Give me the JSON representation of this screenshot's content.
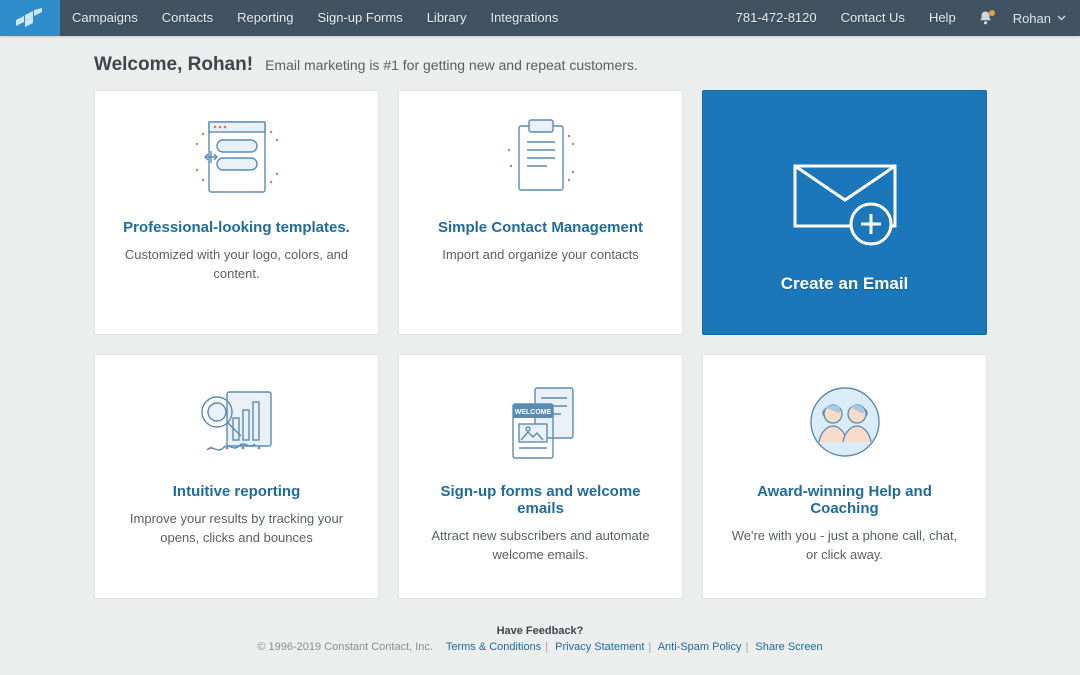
{
  "nav": {
    "items": [
      "Campaigns",
      "Contacts",
      "Reporting",
      "Sign-up Forms",
      "Library",
      "Integrations"
    ],
    "phone": "781-472-8120",
    "contact": "Contact Us",
    "help": "Help",
    "user": "Rohan"
  },
  "header": {
    "title": "Welcome, Rohan!",
    "subtitle": "Email marketing is #1 for getting new and repeat customers."
  },
  "cards": [
    {
      "title": "Professional-looking templates.",
      "desc": "Customized with your logo, colors, and content."
    },
    {
      "title": "Simple Contact Management",
      "desc": "Import and organize your contacts"
    },
    {
      "title": "Create an Email"
    },
    {
      "title": "Intuitive reporting",
      "desc": "Improve your results by tracking your opens, clicks and bounces"
    },
    {
      "title": "Sign-up forms and welcome emails",
      "desc": "Attract new subscribers and automate welcome emails."
    },
    {
      "title": "Award-winning Help and Coaching",
      "desc": "We're with you - just a phone call, chat, or click away."
    }
  ],
  "footer": {
    "feedback": "Have Feedback?",
    "copyright": "© 1996-2019 Constant Contact, Inc.",
    "links": [
      "Terms & Conditions",
      "Privacy Statement",
      "Anti-Spam Policy",
      "Share Screen"
    ]
  }
}
